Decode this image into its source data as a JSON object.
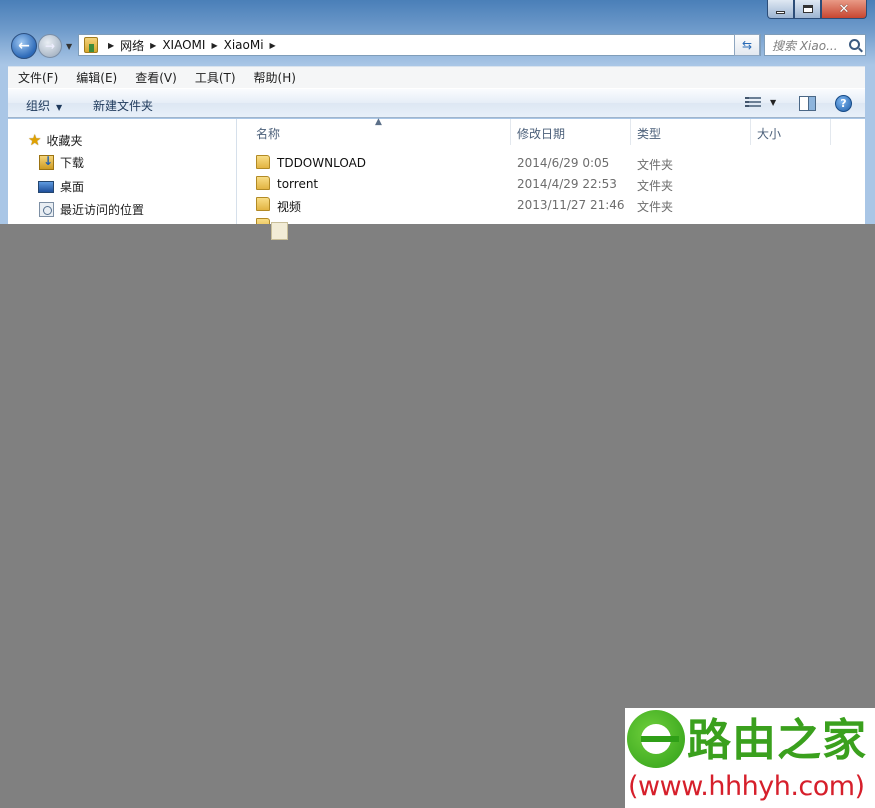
{
  "window": {
    "close_glyph": "✕"
  },
  "address_bar": {
    "crumbs": [
      "网络",
      "XIAOMI",
      "XiaoMi"
    ]
  },
  "search": {
    "placeholder": "搜索 Xiao..."
  },
  "menu": {
    "items": [
      "文件(F)",
      "编辑(E)",
      "查看(V)",
      "工具(T)",
      "帮助(H)"
    ]
  },
  "toolbar": {
    "organize_label": "组织",
    "new_folder_label": "新建文件夹",
    "help_glyph": "?"
  },
  "nav_pane": {
    "items": [
      {
        "label": "收藏夹",
        "icon": "star-icon"
      },
      {
        "label": "下载",
        "icon": "downloads-icon"
      },
      {
        "label": "桌面",
        "icon": "desktop-icon"
      },
      {
        "label": "最近访问的位置",
        "icon": "recent-places-icon"
      }
    ]
  },
  "file_list": {
    "columns": [
      "名称",
      "修改日期",
      "类型",
      "大小"
    ],
    "rows": [
      {
        "name": "TDDOWNLOAD",
        "modified": "2014/6/29 0:05",
        "type": "文件夹"
      },
      {
        "name": "torrent",
        "modified": "2014/4/29 22:53",
        "type": "文件夹"
      },
      {
        "name": "视频",
        "modified": "2013/11/27 21:46",
        "type": "文件夹"
      }
    ]
  },
  "watermark": {
    "name": "路由之家",
    "url": "(www.hhhyh.com)"
  },
  "colors": {
    "overlay": "#808080",
    "watermark_green": "#3aa01d",
    "watermark_red": "#d61f2b",
    "title_blue": "#4a7fb8"
  }
}
